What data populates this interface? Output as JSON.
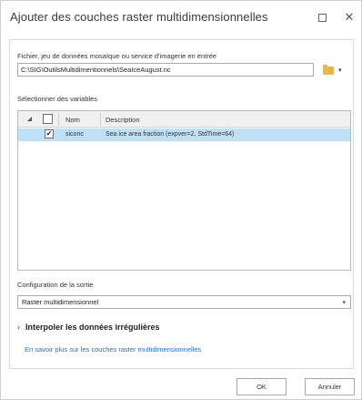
{
  "window": {
    "title": "Ajouter des couches raster multidimensionnelles",
    "maximize_icon": "maximize-icon",
    "close_glyph": "✕"
  },
  "input": {
    "label": "Fichier, jeu de données mosaïque ou service d'imagerie en entrée",
    "value": "C:\\SIG\\OutilsMultidimentionnels\\SeaIceAugust.nc",
    "browse_icon": "folder-icon",
    "dropdown_glyph": "▾"
  },
  "variables": {
    "label": "Sélectionner des variables",
    "columns": [
      "Nom",
      "Description"
    ],
    "rows": [
      {
        "checked": true,
        "name": "siconc",
        "description": "Sea ice area fraction (expver=2, StdTime=64)"
      }
    ]
  },
  "output": {
    "label": "Configuration de la sortie",
    "selected": "Raster multidimensionnel",
    "caret_glyph": "▾"
  },
  "interpolate": {
    "label": "Interpoler les données irrégulières",
    "chevron_glyph": "›"
  },
  "help_link": "En savoir plus sur les couches raster multidimensionnelles",
  "buttons": {
    "ok": "OK",
    "cancel": "Annuler"
  },
  "colors": {
    "selected_row": "#bfe0f5",
    "link": "#2a6eb8",
    "folder": "#e8b84b"
  }
}
